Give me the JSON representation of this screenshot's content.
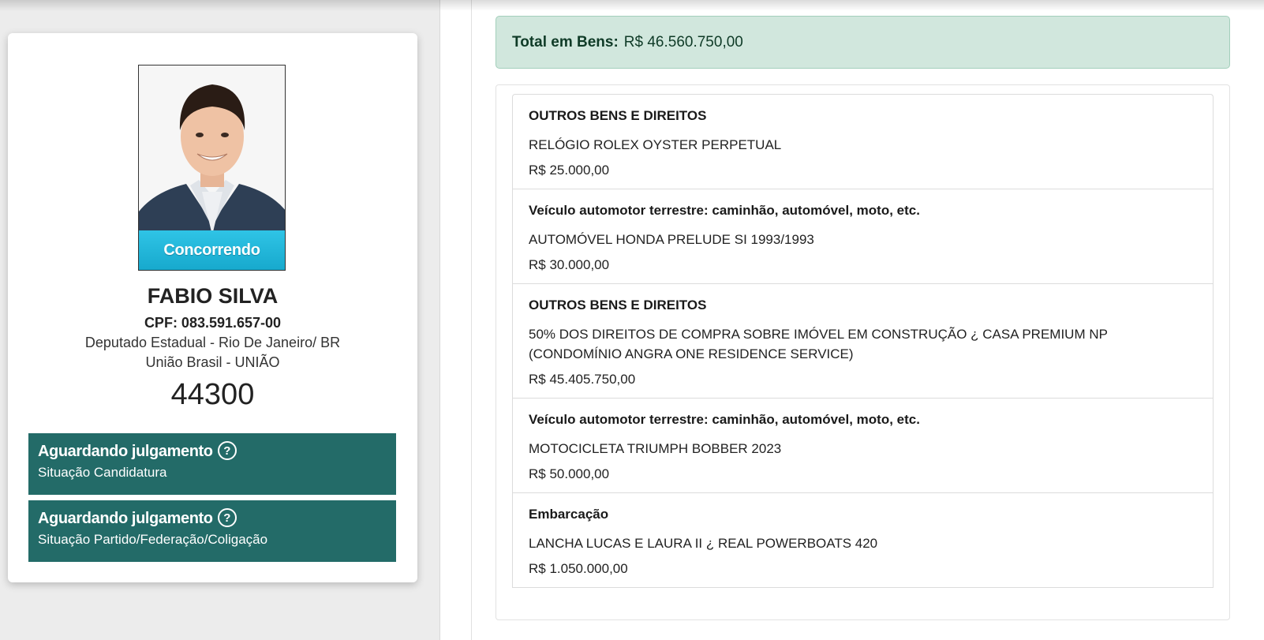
{
  "candidate": {
    "status_ribbon": "Concorrendo",
    "name": "FABIO SILVA",
    "cpf": "CPF: 083.591.657-00",
    "office": "Deputado Estadual - Rio De Janeiro/ BR",
    "party": "União Brasil - UNIÃO",
    "number": "44300",
    "statuses": [
      {
        "title": "Aguardando julgamento",
        "subtitle": "Situação Candidatura",
        "icon": "help-icon"
      },
      {
        "title": "Aguardando julgamento",
        "subtitle": "Situação Partido/Federação/Coligação",
        "icon": "help-icon"
      }
    ]
  },
  "assets": {
    "total_label": "Total em Bens:",
    "total_value": "R$ 46.560.750,00",
    "items": [
      {
        "type": "OUTROS BENS E DIREITOS",
        "description": "RELÓGIO ROLEX OYSTER PERPETUAL",
        "value": "R$ 25.000,00"
      },
      {
        "type": "Veículo automotor terrestre: caminhão, automóvel, moto, etc.",
        "description": "AUTOMÓVEL HONDA PRELUDE SI 1993/1993",
        "value": "R$ 30.000,00"
      },
      {
        "type": "OUTROS BENS E DIREITOS",
        "description": "50% DOS DIREITOS DE COMPRA SOBRE IMÓVEL EM CONSTRUÇÃO ¿ CASA PREMIUM NP (CONDOMÍNIO ANGRA ONE RESIDENCE SERVICE)",
        "value": "R$ 45.405.750,00"
      },
      {
        "type": "Veículo automotor terrestre: caminhão, automóvel, moto, etc.",
        "description": "MOTOCICLETA TRIUMPH BOBBER 2023",
        "value": "R$ 50.000,00"
      },
      {
        "type": "Embarcação",
        "description": "LANCHA LUCAS E LAURA II ¿ REAL POWERBOATS 420",
        "value": "R$ 1.050.000,00"
      }
    ]
  },
  "colors": {
    "status_box": "#236b68",
    "ribbon": "#1fb5d9",
    "alert_bg": "#d1e7dd"
  }
}
